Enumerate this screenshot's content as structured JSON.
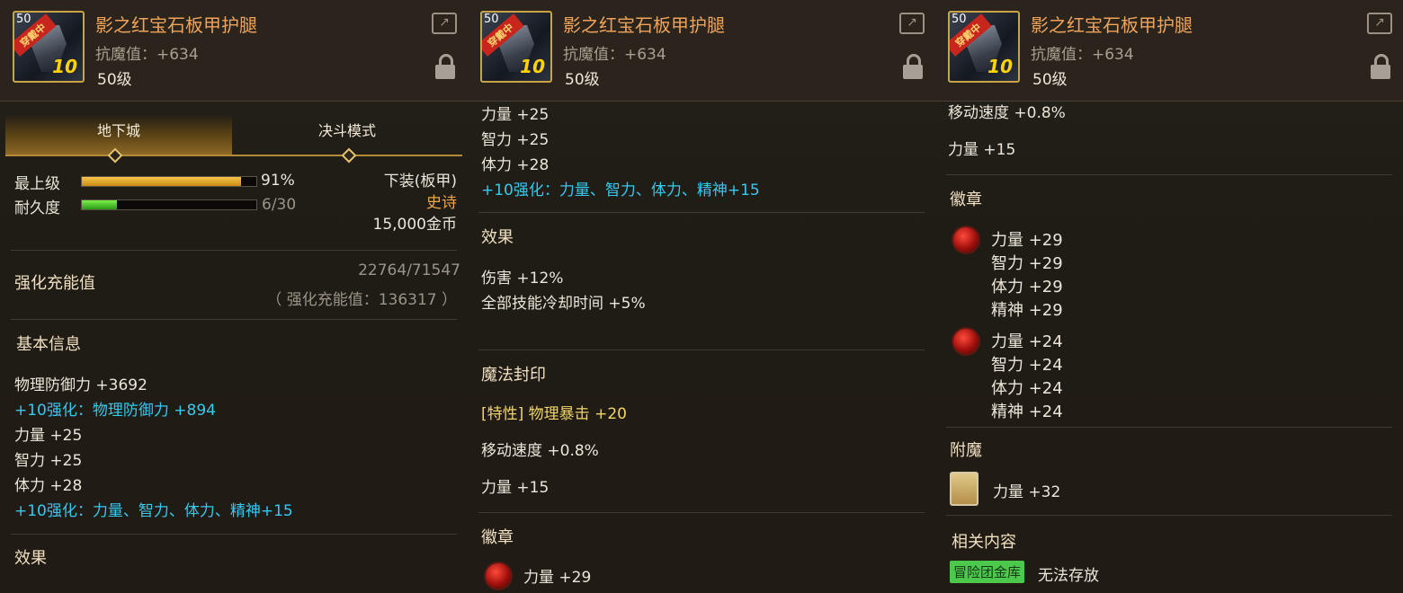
{
  "item": {
    "name": "影之红宝石板甲护腿",
    "magic_resist": "抗魔值：+634",
    "level": "50级",
    "icon_level": "50",
    "icon_ribbon": "穿戴中",
    "icon_reinforce": "10"
  },
  "tabs": [
    "地下城",
    "决斗模式"
  ],
  "stats": {
    "top_grade_label": "最上级",
    "top_grade_value": "91%",
    "top_grade_fraction": 0.91,
    "durability_label": "耐久度",
    "durability_value": "6/30",
    "durability_fraction": 0.2,
    "slot": "下装(板甲)",
    "rarity": "史诗",
    "price": "15,000金币"
  },
  "reinforce_charge": {
    "label": "强化充能值",
    "progress": "22764/71547",
    "detail": "（ 强化充能值：136317 ）"
  },
  "basic_info": {
    "title": "基本信息",
    "phys_def": "物理防御力 +3692",
    "reinforce_def": "+10强化：物理防御力 +894",
    "str": "力量 +25",
    "int": "智力 +25",
    "vit": "体力 +28",
    "reinforce_stats": "+10强化：力量、智力、体力、精神+15"
  },
  "effect": {
    "title": "效果",
    "damage": "伤害 +12%",
    "cooldown": "全部技能冷却时间 +5%"
  },
  "magic_seal": {
    "title": "魔法封印",
    "trait": "[特性] 物理暴击 +20",
    "move_speed": "移动速度 +0.8%",
    "str": "力量 +15"
  },
  "emblem": {
    "title": "徽章",
    "gem1": [
      "力量 +29",
      "智力 +29",
      "体力 +29",
      "精神 +29"
    ],
    "gem2": [
      "力量 +24",
      "智力 +24",
      "体力 +24",
      "精神 +24"
    ]
  },
  "enchant": {
    "title": "附魔",
    "value": "力量 +32"
  },
  "related": {
    "title": "相关内容",
    "badge": "冒险团金库",
    "note": "无法存放"
  },
  "colors": {
    "title_orange": "#f0a35a",
    "reinforce_cyan": "#36c9f0",
    "rarity_orange": "#f0a64a",
    "badge_green": "#4cc94c"
  }
}
